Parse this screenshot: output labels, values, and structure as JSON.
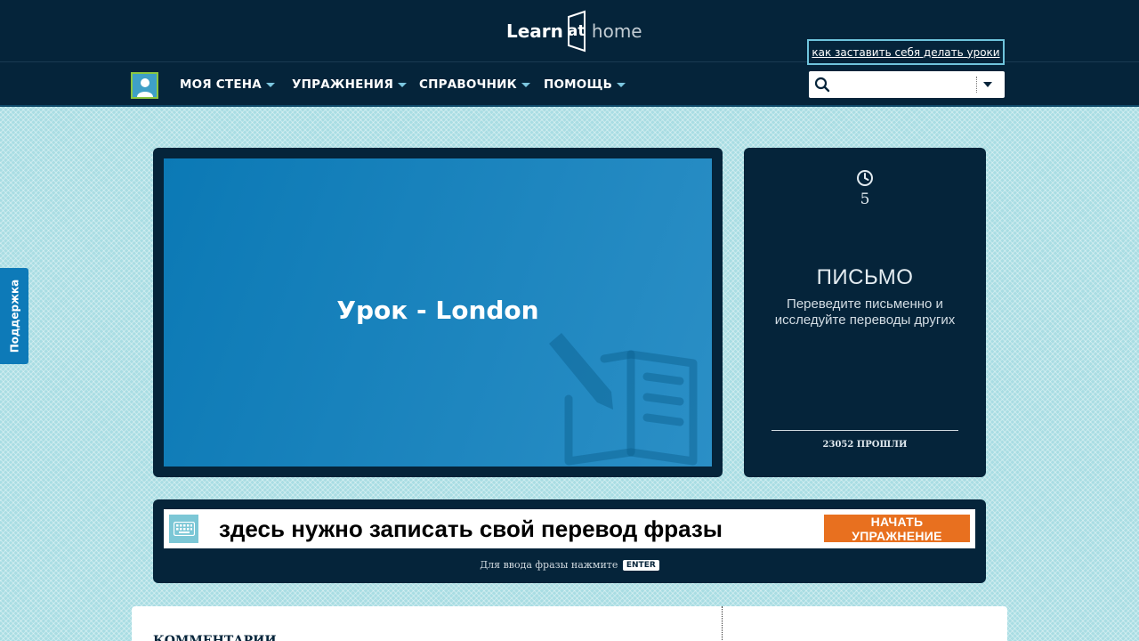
{
  "header": {
    "logo": {
      "learn": "Learn",
      "at": "at",
      "home": "home"
    }
  },
  "nav": {
    "items": [
      {
        "label": "МОЯ СТЕНА"
      },
      {
        "label": "УПРАЖНЕНИЯ"
      },
      {
        "label": "СПРАВОЧНИК"
      },
      {
        "label": "ПОМОЩЬ"
      }
    ],
    "hint_link": "как заставить себя делать уроки",
    "search": {
      "value": "",
      "placeholder": ""
    }
  },
  "support_tab": {
    "label": "Поддержка"
  },
  "lesson": {
    "title": "Урок - London"
  },
  "side_card": {
    "time": "5",
    "title": "ПИСЬМО",
    "description": "Переведите письменно и исследуйте переводы других",
    "completed": "23052 ПРОШЛИ"
  },
  "exercise": {
    "input_value": "здесь нужно записать свой перевод фразы",
    "start_button": "НАЧАТЬ УПРАЖНЕНИЕ",
    "enter_hint": "Для ввода фразы нажмите",
    "enter_key": "ENTER"
  },
  "comments": {
    "title": "КОММЕНТАРИИ"
  },
  "colors": {
    "header_bg": "#05243a",
    "accent_orange": "#e8701f",
    "lesson_blue": "#1a86c0",
    "page_bg": "#a9dde3"
  }
}
